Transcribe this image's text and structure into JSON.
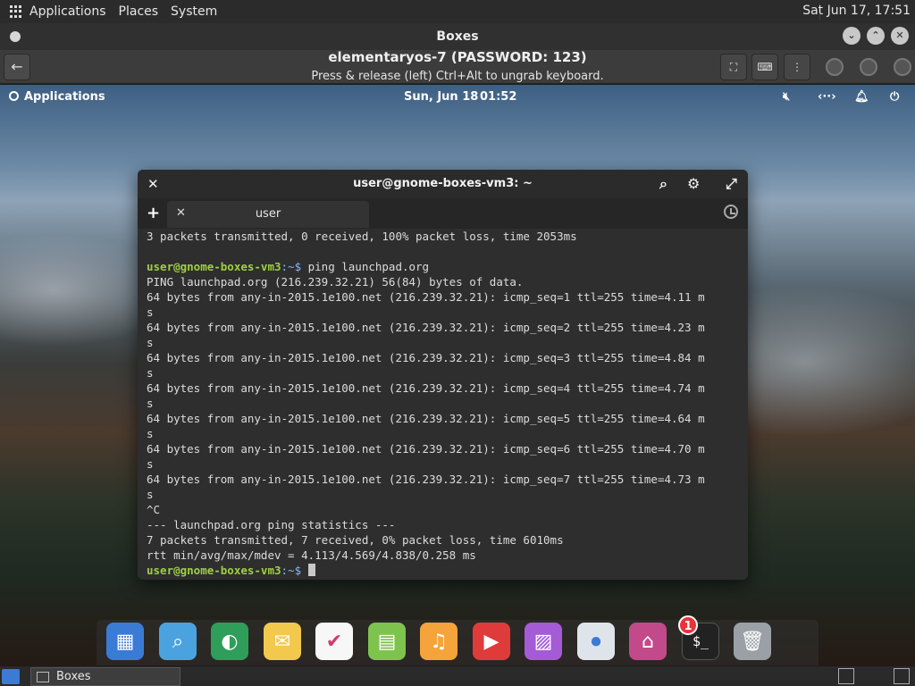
{
  "host_panel": {
    "menus": [
      "Applications",
      "Places",
      "System"
    ],
    "clock": "Sat Jun 17, 17:51"
  },
  "boxes_window": {
    "title": "Boxes",
    "vm_title": "elementaryos-7 (PASSWORD: 123)",
    "vm_subtitle": "Press & release (left) Ctrl+Alt to ungrab keyboard."
  },
  "guest_panel": {
    "applications_label": "Applications",
    "date": "Sun, Jun 18",
    "time": "01:52"
  },
  "terminal": {
    "title": "user@gnome-boxes-vm3: ~",
    "tab_label": "user",
    "prompt_user": "user@gnome-boxes-vm3",
    "prompt_path": ":~$",
    "lines": [
      "3 packets transmitted, 0 received, 100% packet loss, time 2053ms",
      "",
      "@PROMPT ping launchpad.org",
      "PING launchpad.org (216.239.32.21) 56(84) bytes of data.",
      "64 bytes from any-in-2015.1e100.net (216.239.32.21): icmp_seq=1 ttl=255 time=4.11 m",
      "s",
      "64 bytes from any-in-2015.1e100.net (216.239.32.21): icmp_seq=2 ttl=255 time=4.23 m",
      "s",
      "64 bytes from any-in-2015.1e100.net (216.239.32.21): icmp_seq=3 ttl=255 time=4.84 m",
      "s",
      "64 bytes from any-in-2015.1e100.net (216.239.32.21): icmp_seq=4 ttl=255 time=4.74 m",
      "s",
      "64 bytes from any-in-2015.1e100.net (216.239.32.21): icmp_seq=5 ttl=255 time=4.64 m",
      "s",
      "64 bytes from any-in-2015.1e100.net (216.239.32.21): icmp_seq=6 ttl=255 time=4.70 m",
      "s",
      "64 bytes from any-in-2015.1e100.net (216.239.32.21): icmp_seq=7 ttl=255 time=4.73 m",
      "s",
      "^C",
      "--- launchpad.org ping statistics ---",
      "7 packets transmitted, 7 received, 0% packet loss, time 6010ms",
      "rtt min/avg/max/mdev = 4.113/4.569/4.838/0.258 ms",
      "@PROMPT_CURSOR"
    ]
  },
  "dock": {
    "items": [
      {
        "name": "multitasking-view-icon",
        "color": "#3a7bd5"
      },
      {
        "name": "files-icon",
        "color": "#4aa3df"
      },
      {
        "name": "web-browser-icon",
        "color": "#2e9e5a"
      },
      {
        "name": "mail-icon",
        "color": "#f2c94c"
      },
      {
        "name": "tasks-icon",
        "color": "#f7f7f7"
      },
      {
        "name": "calendar-icon",
        "color": "#7fc34f"
      },
      {
        "name": "music-icon",
        "color": "#f5a33b"
      },
      {
        "name": "videos-icon",
        "color": "#e03b3b"
      },
      {
        "name": "photos-icon",
        "color": "#a65bd6"
      },
      {
        "name": "system-settings-icon",
        "color": "#dfe4ea"
      },
      {
        "name": "appcenter-icon",
        "color": "#c24a8a"
      },
      {
        "name": "terminal-icon",
        "color": "#222222"
      },
      {
        "name": "trash-icon",
        "color": "#9aa0a6"
      }
    ],
    "appcenter_badge": "1"
  },
  "host_taskbar": {
    "task_label": "Boxes"
  }
}
